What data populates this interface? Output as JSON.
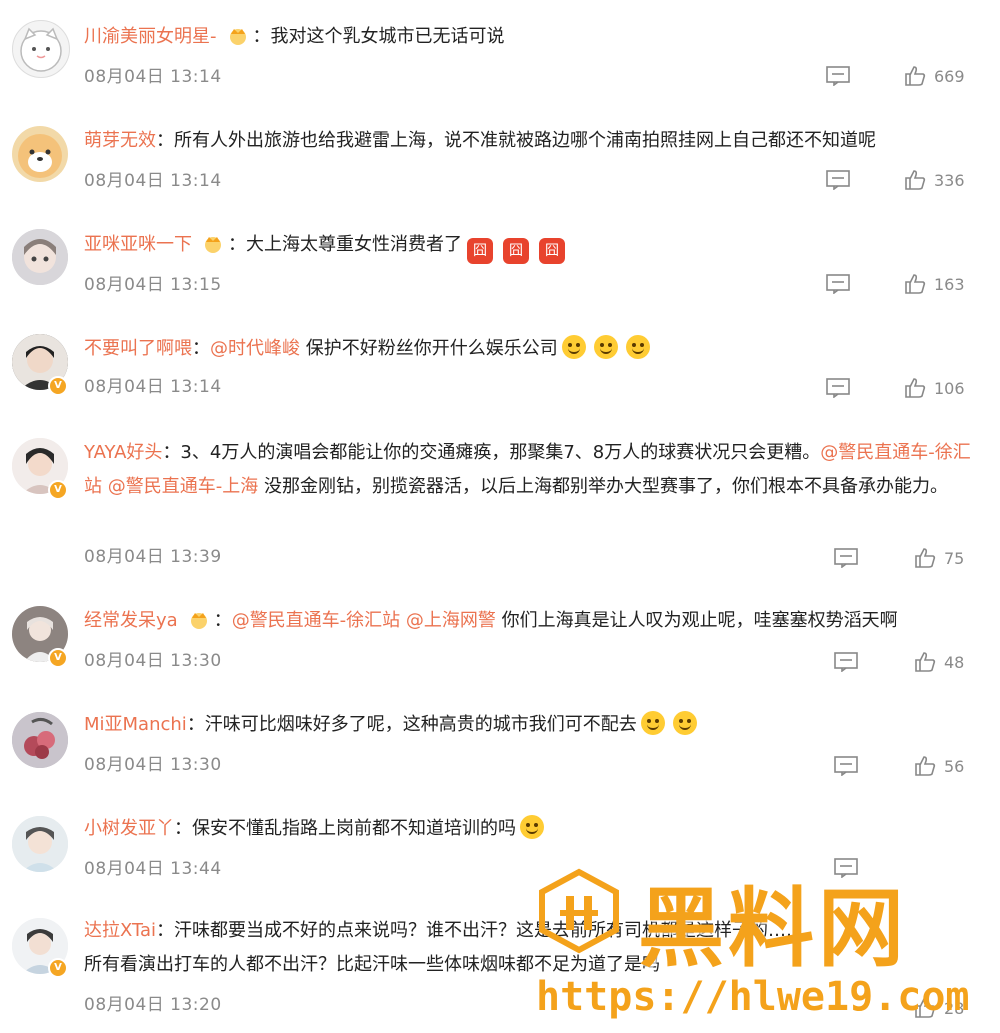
{
  "comments": [
    {
      "username": "川渝美丽女明星-",
      "has_crown": true,
      "text": "：我对这个乳女城市已无话可说",
      "time": "08月04日 13:14",
      "likes": "669"
    },
    {
      "username": "萌芽无效",
      "has_crown": false,
      "text": "：所有人外出旅游也给我避雷上海，说不准就被路边哪个浦南拍照挂网上自己都还不知道呢",
      "time": "08月04日 13:14",
      "likes": "336"
    },
    {
      "username": "亚咪亚咪一下",
      "has_crown": true,
      "text": "：大上海太尊重女性消费者了",
      "stickers": [
        "囧",
        "囧",
        "囧"
      ],
      "time": "08月04日 13:15",
      "likes": "163"
    },
    {
      "username": "不要叫了啊喂",
      "has_crown": false,
      "text_prefix": "：",
      "mention": "@时代峰峻",
      "text": " 保护不好粉丝你开什么娱乐公司",
      "emoji_count": 3,
      "time": "08月04日 13:14",
      "likes": "106"
    },
    {
      "username": "YAYA好头",
      "line1": "：3、4万人的演唱会都能让你的交通瘫痪，那聚集7、8万人的球赛状况只会更糟。",
      "mention1": "@警民直通车-徐汇站",
      "mention2": "@警民直通车-上海",
      "line2": " 没那金刚钻，别揽瓷器活，以后上海都别举办大型赛事了，你们根本不具备承办能力。",
      "time": "08月04日 13:39",
      "likes": "75"
    },
    {
      "username": "经常发呆ya",
      "has_crown": true,
      "text_prefix": "：",
      "mention1": "@警民直通车-徐汇站",
      "mention2": "@上海网警",
      "text": " 你们上海真是让人叹为观止呢，哇塞塞权势滔天啊",
      "time": "08月04日 13:30",
      "likes": "48"
    },
    {
      "username": "Mi亚Manchi",
      "text": "：汗味可比烟味好多了呢，这种高贵的城市我们可不配去",
      "emoji_count": 2,
      "time": "08月04日 13:30",
      "likes": "56"
    },
    {
      "username": "小树发亚丫",
      "text": "：保安不懂乱指路上岗前都不知道培训的吗",
      "emoji_count": 1,
      "time": "08月04日 13:44",
      "likes": ""
    },
    {
      "username": "达拉XTai",
      "line1": "：汗味都要当成不好的点来说吗？谁不出汗？这是去前所有司机都是这样子的……",
      "line2": "所有看演出打车的人都不出汗？比起汗味一些体味烟味都不足为道了是吗",
      "time": "08月04日 13:20",
      "likes": "28"
    }
  ],
  "watermark": {
    "text": "黑料网",
    "url": "https://hlwe19.com"
  },
  "colors": {
    "username": "#eb7350",
    "watermark": "#f4a21b",
    "meta": "#8a8a8a"
  }
}
